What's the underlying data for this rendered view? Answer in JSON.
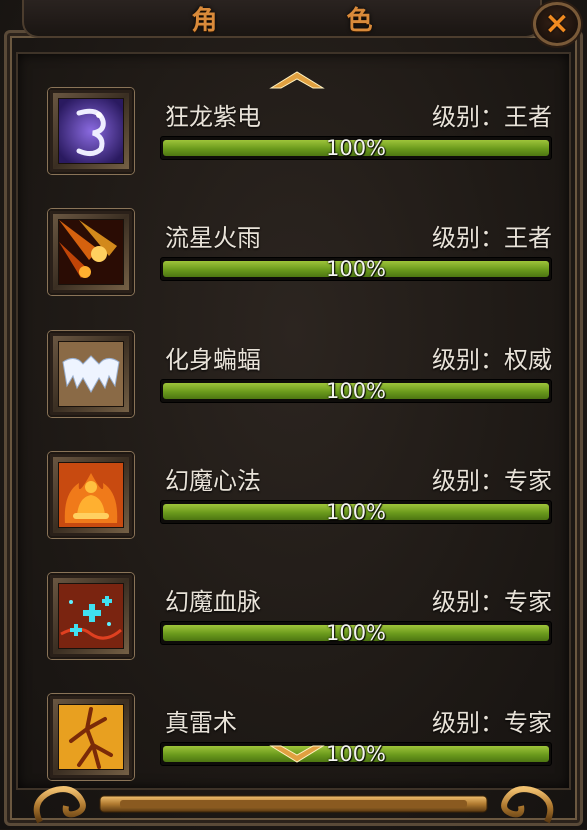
{
  "window": {
    "title": "角 色",
    "close_label": "×"
  },
  "colors": {
    "title": "#d98a3a",
    "progress_fill": "#7fae27",
    "text": "#e8e2d8",
    "close": "#f08a20"
  },
  "skills": [
    {
      "name": "狂龙紫电",
      "level": "级别：王者",
      "progress": "100%",
      "progress_value": 1.0,
      "icon": "purple-dragon-lightning-icon"
    },
    {
      "name": "流星火雨",
      "level": "级别：王者",
      "progress": "100%",
      "progress_value": 1.0,
      "icon": "meteor-fire-rain-icon"
    },
    {
      "name": "化身蝙蝠",
      "level": "级别：权威",
      "progress": "100%",
      "progress_value": 1.0,
      "icon": "bat-wings-icon"
    },
    {
      "name": "幻魔心法",
      "level": "级别：专家",
      "progress": "100%",
      "progress_value": 1.0,
      "icon": "meditating-flame-icon"
    },
    {
      "name": "幻魔血脉",
      "level": "级别：专家",
      "progress": "100%",
      "progress_value": 1.0,
      "icon": "blood-vessel-cross-icon"
    },
    {
      "name": "真雷术",
      "level": "级别：专家",
      "progress": "100%",
      "progress_value": 1.0,
      "icon": "thunder-branch-icon"
    }
  ]
}
